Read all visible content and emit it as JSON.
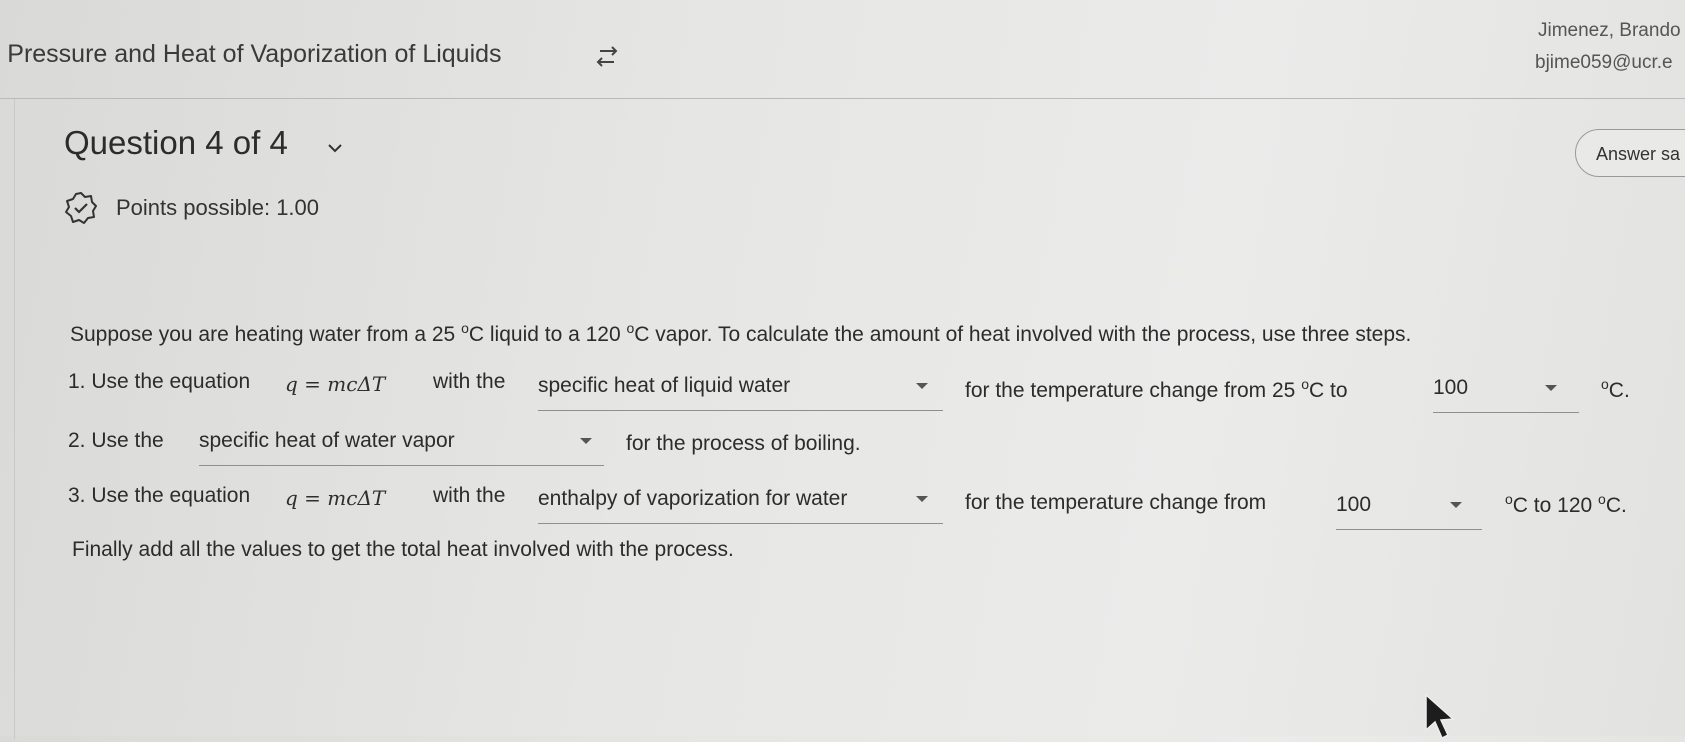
{
  "header": {
    "title": "r Pressure and Heat of Vaporization of Liquids",
    "user_name": "Jimenez, Brando",
    "user_email": "bjime059@ucr.e"
  },
  "question": {
    "heading": "Question 4 of 4",
    "points": "Points possible: 1.00",
    "answer_button": "Answer sa"
  },
  "body": {
    "intro_part1": "Suppose you are heating water from a 25 ",
    "intro_sup1": "o",
    "intro_part2": "C liquid to a 120 ",
    "intro_sup2": "o",
    "intro_part3": "C vapor. To calculate the amount of heat involved with the process, use three steps.",
    "equation": "q = mcΔT",
    "deg": "o",
    "step1": {
      "prefix": "1. Use the equation",
      "with": "with the",
      "dropdown1": "specific heat of liquid water",
      "mid": "for the temperature change from 25 ",
      "to": "C to",
      "dropdown2": "100",
      "suffix": "C."
    },
    "step2": {
      "prefix": "2. Use the",
      "dropdown": "specific heat of water vapor",
      "suffix": "for the process of boiling."
    },
    "step3": {
      "prefix": "3. Use the equation",
      "with": "with the",
      "dropdown1": "enthalpy of vaporization for water",
      "mid": "for the temperature change from",
      "dropdown2": "100",
      "to": "C to 120 ",
      "suffix": "C."
    },
    "final": "Finally add all the values to get the total heat involved with the process."
  }
}
